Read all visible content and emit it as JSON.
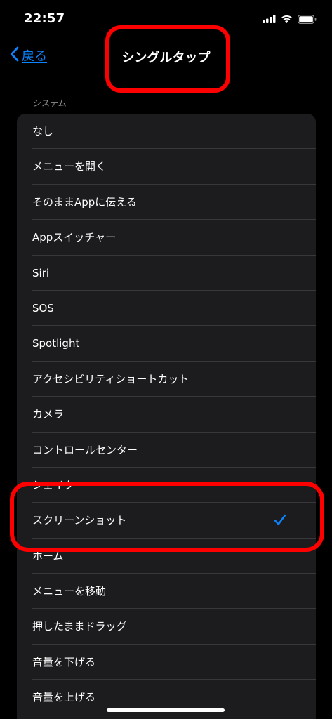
{
  "status_bar": {
    "time": "22:57",
    "icons": [
      "cellular-signal-icon",
      "wifi-icon",
      "battery-icon"
    ]
  },
  "nav": {
    "back_label": "戻る",
    "title": "シングルタップ"
  },
  "section": {
    "header": "システム",
    "items": [
      {
        "label": "なし",
        "selected": false
      },
      {
        "label": "メニューを開く",
        "selected": false
      },
      {
        "label": "そのままAppに伝える",
        "selected": false
      },
      {
        "label": "Appスイッチャー",
        "selected": false
      },
      {
        "label": "Siri",
        "selected": false
      },
      {
        "label": "SOS",
        "selected": false
      },
      {
        "label": "Spotlight",
        "selected": false
      },
      {
        "label": "アクセシビリティショートカット",
        "selected": false
      },
      {
        "label": "カメラ",
        "selected": false
      },
      {
        "label": "コントロールセンター",
        "selected": false
      },
      {
        "label": "シェイク",
        "selected": false
      },
      {
        "label": "スクリーンショット",
        "selected": true
      },
      {
        "label": "ホーム",
        "selected": false
      },
      {
        "label": "メニューを移動",
        "selected": false
      },
      {
        "label": "押したままドラッグ",
        "selected": false
      },
      {
        "label": "音量を下げる",
        "selected": false
      },
      {
        "label": "音量を上げる",
        "selected": false
      }
    ]
  },
  "colors": {
    "accent": "#0a84ff",
    "annotation": "#ff0000",
    "list_background": "#1c1c1e",
    "separator": "#38383a",
    "section_header": "#8d8d93"
  }
}
